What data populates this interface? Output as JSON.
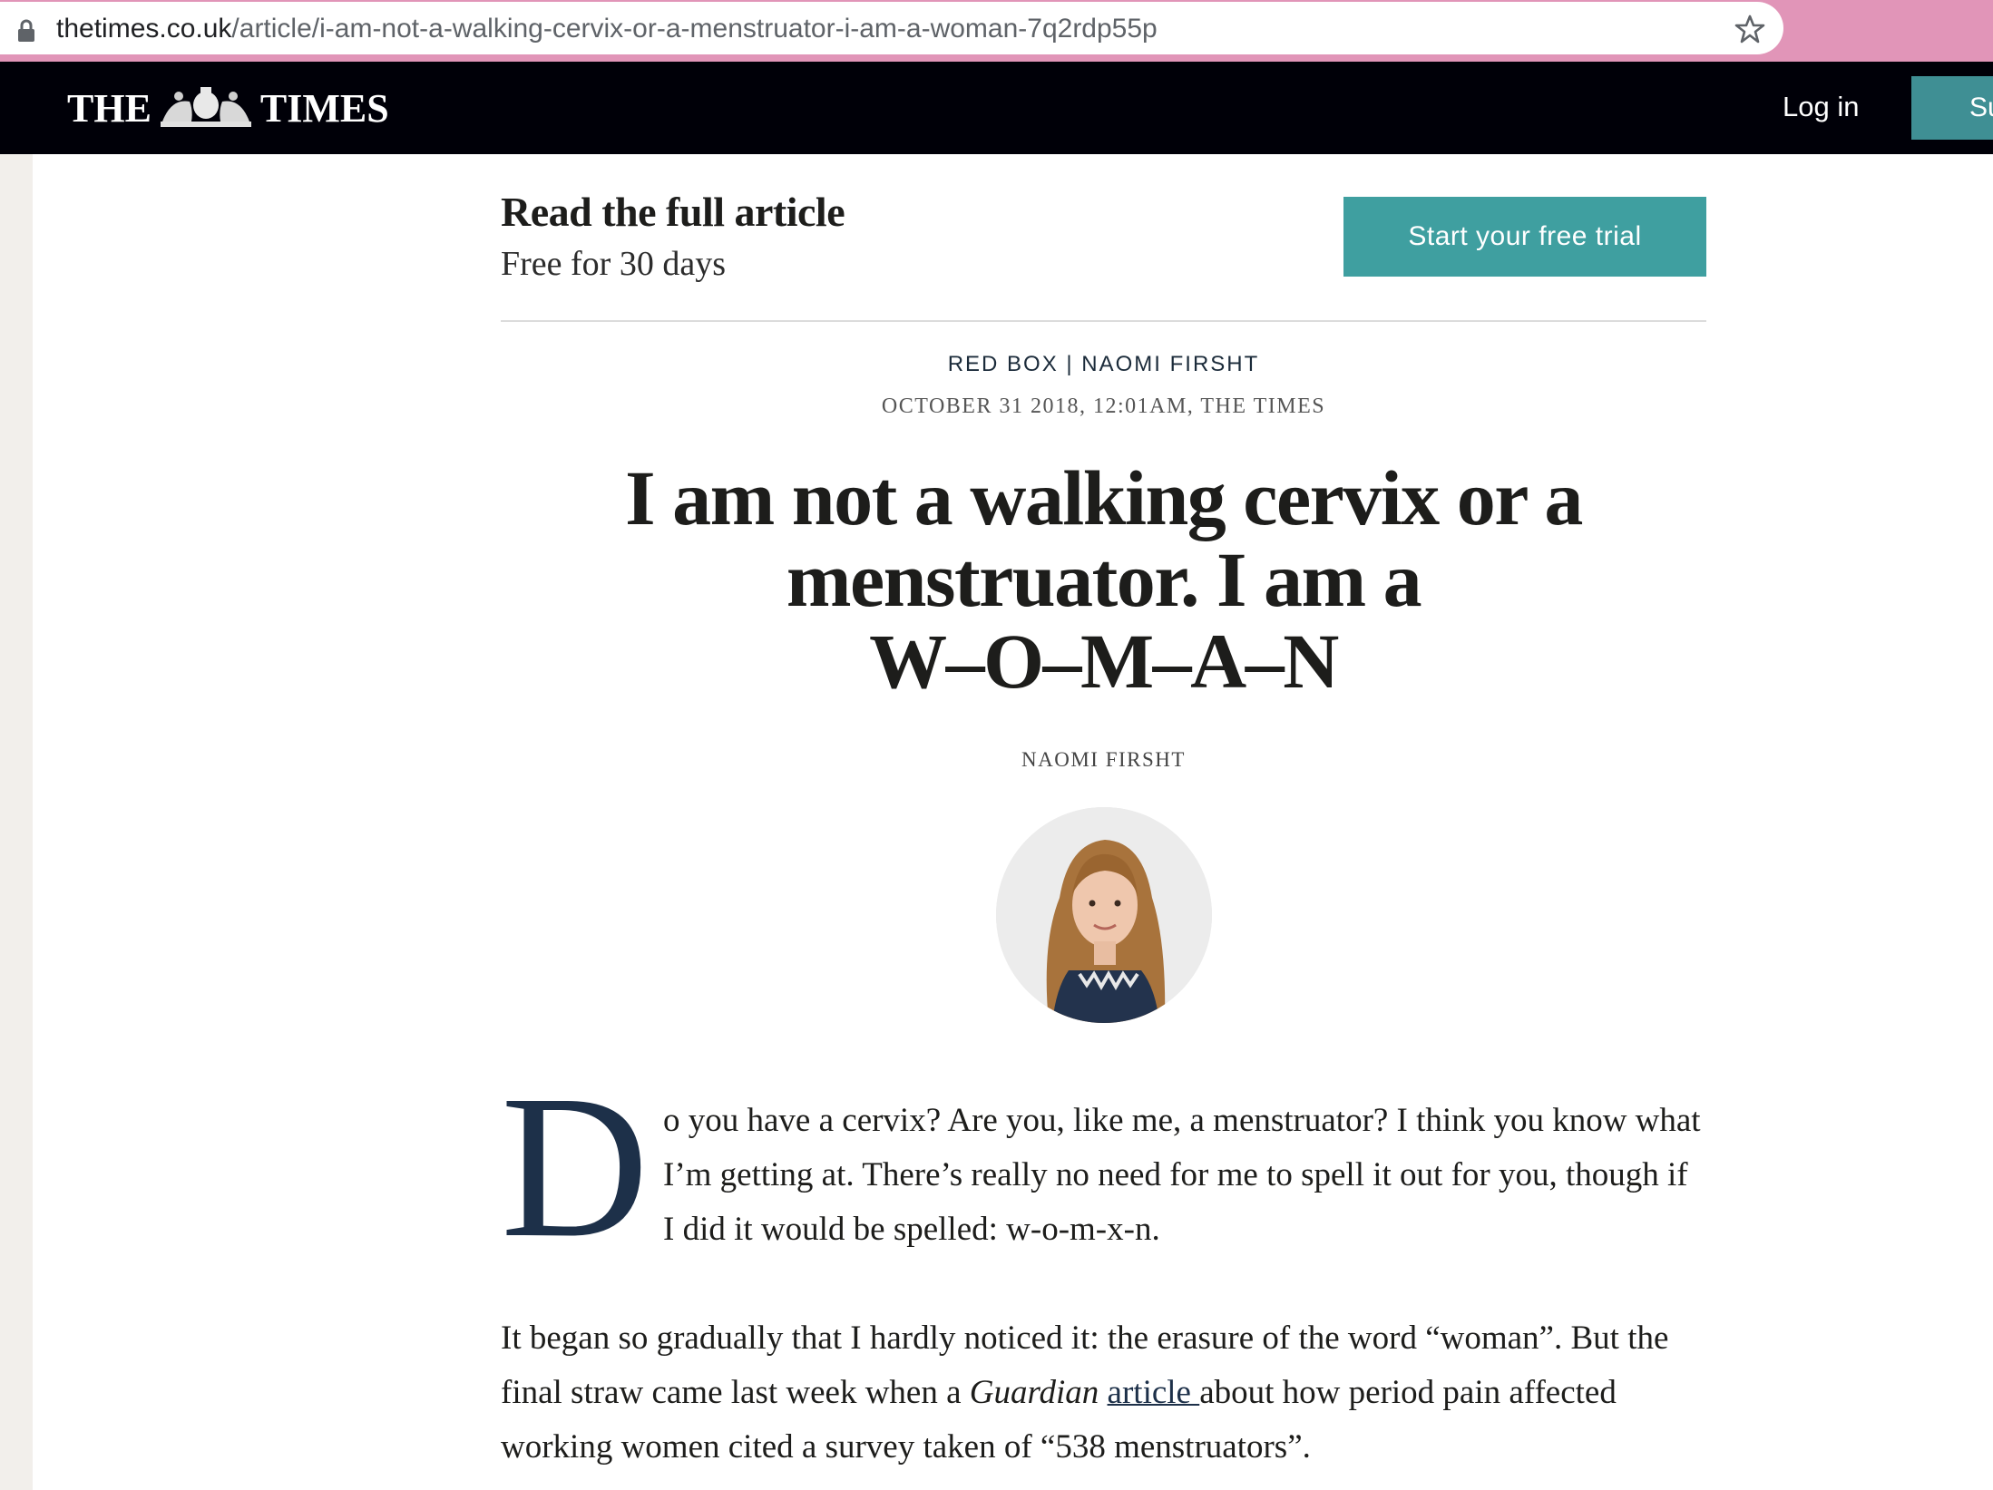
{
  "browser": {
    "url_host": "thetimes.co.uk",
    "url_path": "/article/i-am-not-a-walking-cervix-or-a-menstruator-i-am-a-woman-7q2rdp55p",
    "icons": [
      "lock-icon",
      "star-icon"
    ]
  },
  "header": {
    "logo_left": "THE",
    "logo_right": "TIMES",
    "login_label": "Log in",
    "subscribe_label": "Su"
  },
  "paywall": {
    "title": "Read the full article",
    "subtitle": "Free for 30 days",
    "trial_button": "Start your free trial"
  },
  "article": {
    "section_tag": "RED BOX | NAOMI FIRSHT",
    "dateline": "OCTOBER 31 2018, 12:01AM, THE TIMES",
    "headline_line1": "I am not a walking cervix or a",
    "headline_line2": "menstruator. I am a",
    "headline_line3": "W–O–M–A–N",
    "byline": "NAOMI FIRSHT",
    "drop_cap": "D",
    "lead_text": "o you have a cervix? Are you, like me, a menstruator? I think you know what I’m getting at. There’s really no need for me to spell it out for you, though if I did it would be spelled: w-o-m-x-n.",
    "p2_part1": "It began so gradually that I hardly noticed it: the erasure of the word “woman”. But the final straw came last week when a ",
    "p2_italic": "Guardian",
    "p2_link": "article ",
    "p2_part2": "about how period pain affected working women cited a survey taken of “538 menstruators”."
  },
  "colors": {
    "browser_accent": "#e195b8",
    "header_bg": "#000008",
    "trial_button": "#3f9fa0",
    "subscribe_button": "#3f8f94",
    "drop_cap": "#1d3049"
  }
}
